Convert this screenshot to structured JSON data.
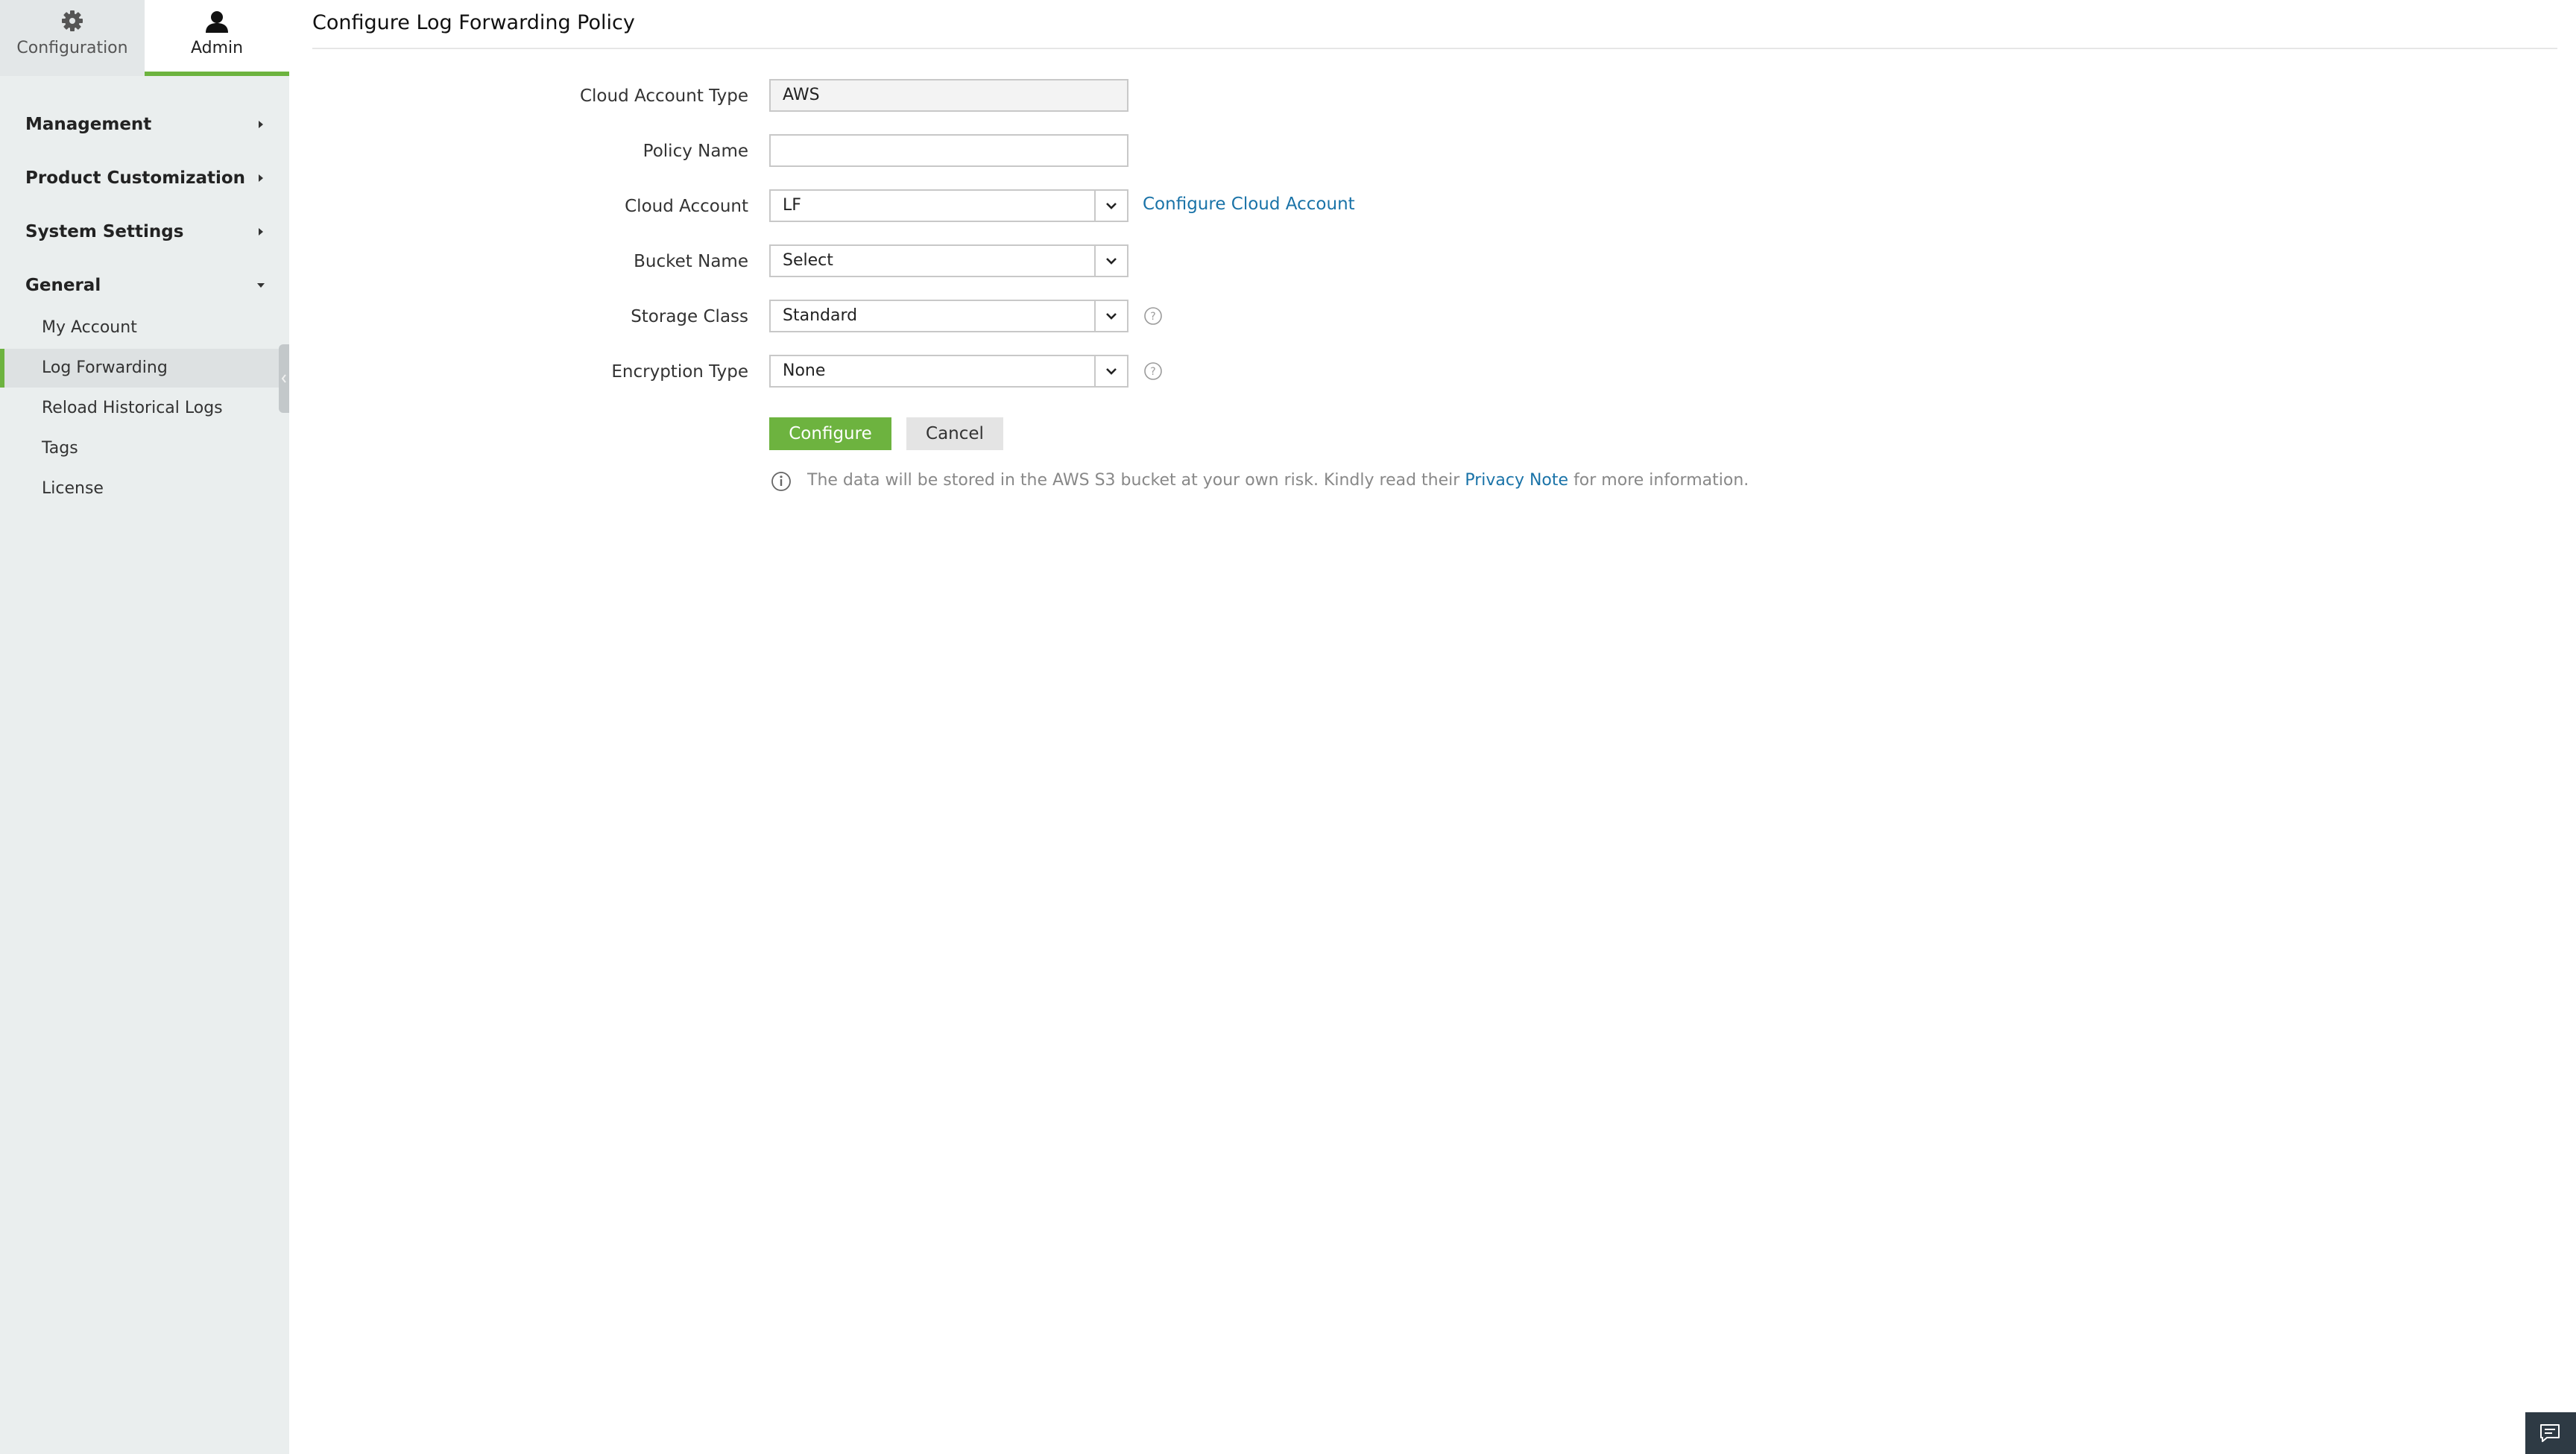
{
  "sidebar": {
    "tabs": [
      {
        "label": "Configuration",
        "icon": "gear-icon"
      },
      {
        "label": "Admin",
        "icon": "user-icon"
      }
    ],
    "active_tab": "Admin",
    "sections": [
      {
        "label": "Management",
        "expanded": false
      },
      {
        "label": "Product Customization",
        "expanded": false
      },
      {
        "label": "System Settings",
        "expanded": false
      },
      {
        "label": "General",
        "expanded": true
      }
    ],
    "general_items": [
      {
        "label": "My Account"
      },
      {
        "label": "Log Forwarding"
      },
      {
        "label": "Reload Historical Logs"
      },
      {
        "label": "Tags"
      },
      {
        "label": "License"
      }
    ],
    "active_item": "Log Forwarding",
    "accent_color": "#6db33f"
  },
  "page": {
    "title": "Configure Log Forwarding Policy"
  },
  "form": {
    "cloud_account_type": {
      "label": "Cloud Account Type",
      "value": "AWS"
    },
    "policy_name": {
      "label": "Policy Name",
      "value": "",
      "placeholder": ""
    },
    "cloud_account": {
      "label": "Cloud Account",
      "value": "LF",
      "link": "Configure Cloud Account"
    },
    "bucket_name": {
      "label": "Bucket Name",
      "value": "Select"
    },
    "storage_class": {
      "label": "Storage Class",
      "value": "Standard"
    },
    "encryption_type": {
      "label": "Encryption Type",
      "value": "None"
    },
    "configure_label": "Configure",
    "cancel_label": "Cancel",
    "note": {
      "prefix": "The data will be stored in the AWS S3 bucket at your own risk. Kindly read their",
      "link": "Privacy Note",
      "suffix": "for more information."
    }
  },
  "colors": {
    "primary_button": "#6db33f",
    "link": "#1a73a8",
    "chat_button": "#2e3a44"
  }
}
